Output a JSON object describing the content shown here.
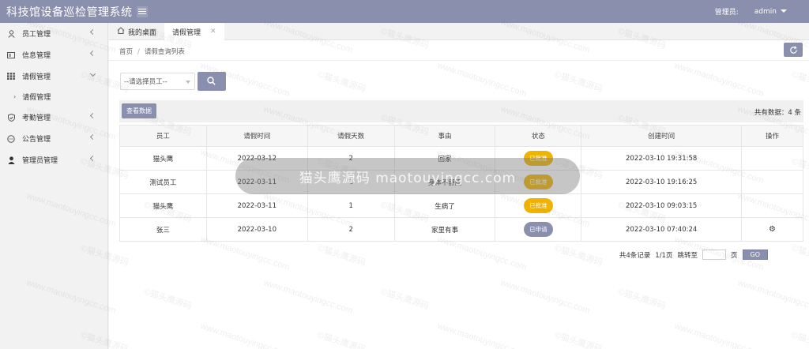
{
  "header": {
    "app_title": "科技馆设备巡检管理系统",
    "admin_label": "管理员:",
    "admin_name": "admin"
  },
  "sidebar": {
    "items": [
      {
        "label": "员工管理",
        "icon": "person-icon"
      },
      {
        "label": "信息管理",
        "icon": "id-card-icon"
      },
      {
        "label": "请假管理",
        "icon": "grid-icon",
        "expanded": true,
        "sub": "请假管理"
      },
      {
        "label": "考勤管理",
        "icon": "shield-icon"
      },
      {
        "label": "公告管理",
        "icon": "chat-icon"
      },
      {
        "label": "管理员管理",
        "icon": "user-icon"
      }
    ]
  },
  "tabs": [
    {
      "label": "我的桌面"
    },
    {
      "label": "请假管理"
    }
  ],
  "breadcrumb": {
    "home": "首页",
    "sep": "/",
    "current": "请假查询列表"
  },
  "filter": {
    "employee_placeholder": "--请选择员工--"
  },
  "toolbar": {
    "view_button": "查看数据",
    "total": "共有数据：4 条"
  },
  "table": {
    "headers": [
      "员工",
      "请假时间",
      "请假天数",
      "事由",
      "状态",
      "创建时间",
      "操作"
    ],
    "rows": [
      {
        "employee": "猫头鹰",
        "date": "2022-03-12",
        "days": "2",
        "reason": "回家",
        "status": "已批准",
        "status_color": "#f0b400",
        "created": "2022-03-10 19:31:58",
        "action": ""
      },
      {
        "employee": "测试员工",
        "date": "2022-03-11",
        "days": "1",
        "reason": "身体不舒服",
        "status": "已批准",
        "status_color": "#f0b400",
        "created": "2022-03-10 19:16:25",
        "action": ""
      },
      {
        "employee": "猫头鹰",
        "date": "2022-03-11",
        "days": "1",
        "reason": "生病了",
        "status": "已批准",
        "status_color": "#f0b400",
        "created": "2022-03-10 09:03:15",
        "action": ""
      },
      {
        "employee": "张三",
        "date": "2022-03-10",
        "days": "2",
        "reason": "家里有事",
        "status": "已申请",
        "status_color": "#8a8fae",
        "created": "2022-03-10 07:40:24",
        "action": "gear"
      }
    ]
  },
  "pager": {
    "summary": "共4条记录",
    "page": "1/1页",
    "jump_label": "跳转至",
    "page_unit": "页",
    "go": "GO"
  },
  "watermark": {
    "banner": "猫头鹰源码 maotouyingcc.com",
    "tile_url": "www.maotouyingcc.com",
    "tile_cn": "©猫头鹰源码"
  },
  "colors": {
    "accent": "#8a8fae",
    "approved": "#f0b400"
  }
}
